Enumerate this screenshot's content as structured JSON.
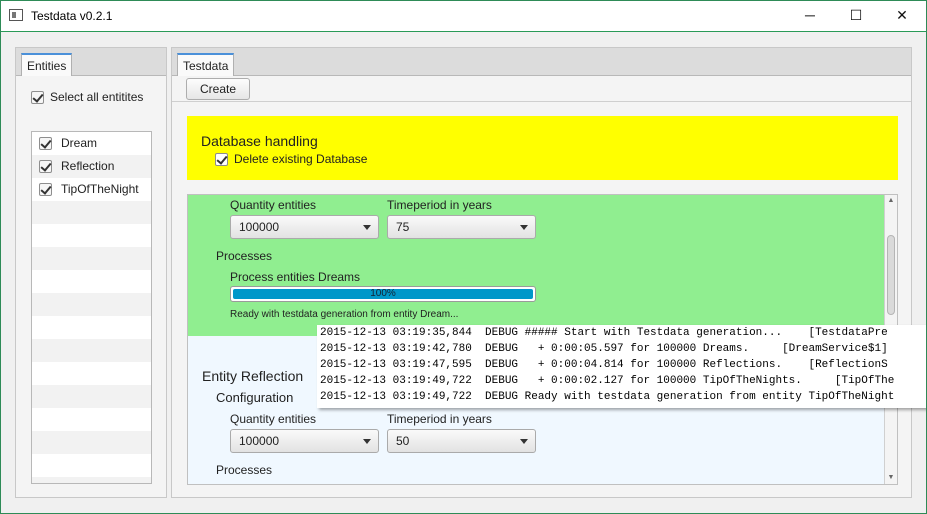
{
  "window": {
    "title": "Testdata v0.2.1",
    "minimize": "─",
    "maximize": "☐",
    "close": "✕"
  },
  "left": {
    "tab": "Entities",
    "select_all": "Select all entitites",
    "items": [
      "Dream",
      "Reflection",
      "TipOfTheNight"
    ]
  },
  "right": {
    "tab": "Testdata",
    "create_button": "Create",
    "database": {
      "title": "Database handling",
      "delete_label": "Delete existing Database"
    },
    "dream": {
      "quantity_label": "Quantity entities",
      "quantity_value": "100000",
      "timeperiod_label": "Timeperiod in years",
      "timeperiod_value": "75",
      "processes_label": "Processes",
      "process_label": "Process entities Dreams",
      "progress_text": "100%",
      "progress_value": 1.0,
      "status": "Ready with testdata generation from entity Dream..."
    },
    "reflection": {
      "title": "Entity Reflection",
      "configuration": "Configuration",
      "quantity_label": "Quantity entities",
      "quantity_value": "100000",
      "timeperiod_label": "Timeperiod in years",
      "timeperiod_value": "50",
      "processes_label": "Processes"
    }
  },
  "log": [
    "2015-12-13 03:19:35,844  DEBUG ##### Start with Testdata generation...    [TestdataPre",
    "2015-12-13 03:19:42,780  DEBUG   + 0:00:05.597 for 100000 Dreams.     [DreamService$1]",
    "2015-12-13 03:19:47,595  DEBUG   + 0:00:04.814 for 100000 Reflections.    [ReflectionS",
    "2015-12-13 03:19:49,722  DEBUG   + 0:00:02.127 for 100000 TipOfTheNights.     [TipOfThe",
    "2015-12-13 03:19:49,722  DEBUG Ready with testdata generation from entity TipOfTheNight"
  ],
  "colors": {
    "database_bg": "#ffff00",
    "dream_bg": "#90ee90",
    "reflection_bg": "#f0f8ff",
    "progress": "#0097c9"
  }
}
